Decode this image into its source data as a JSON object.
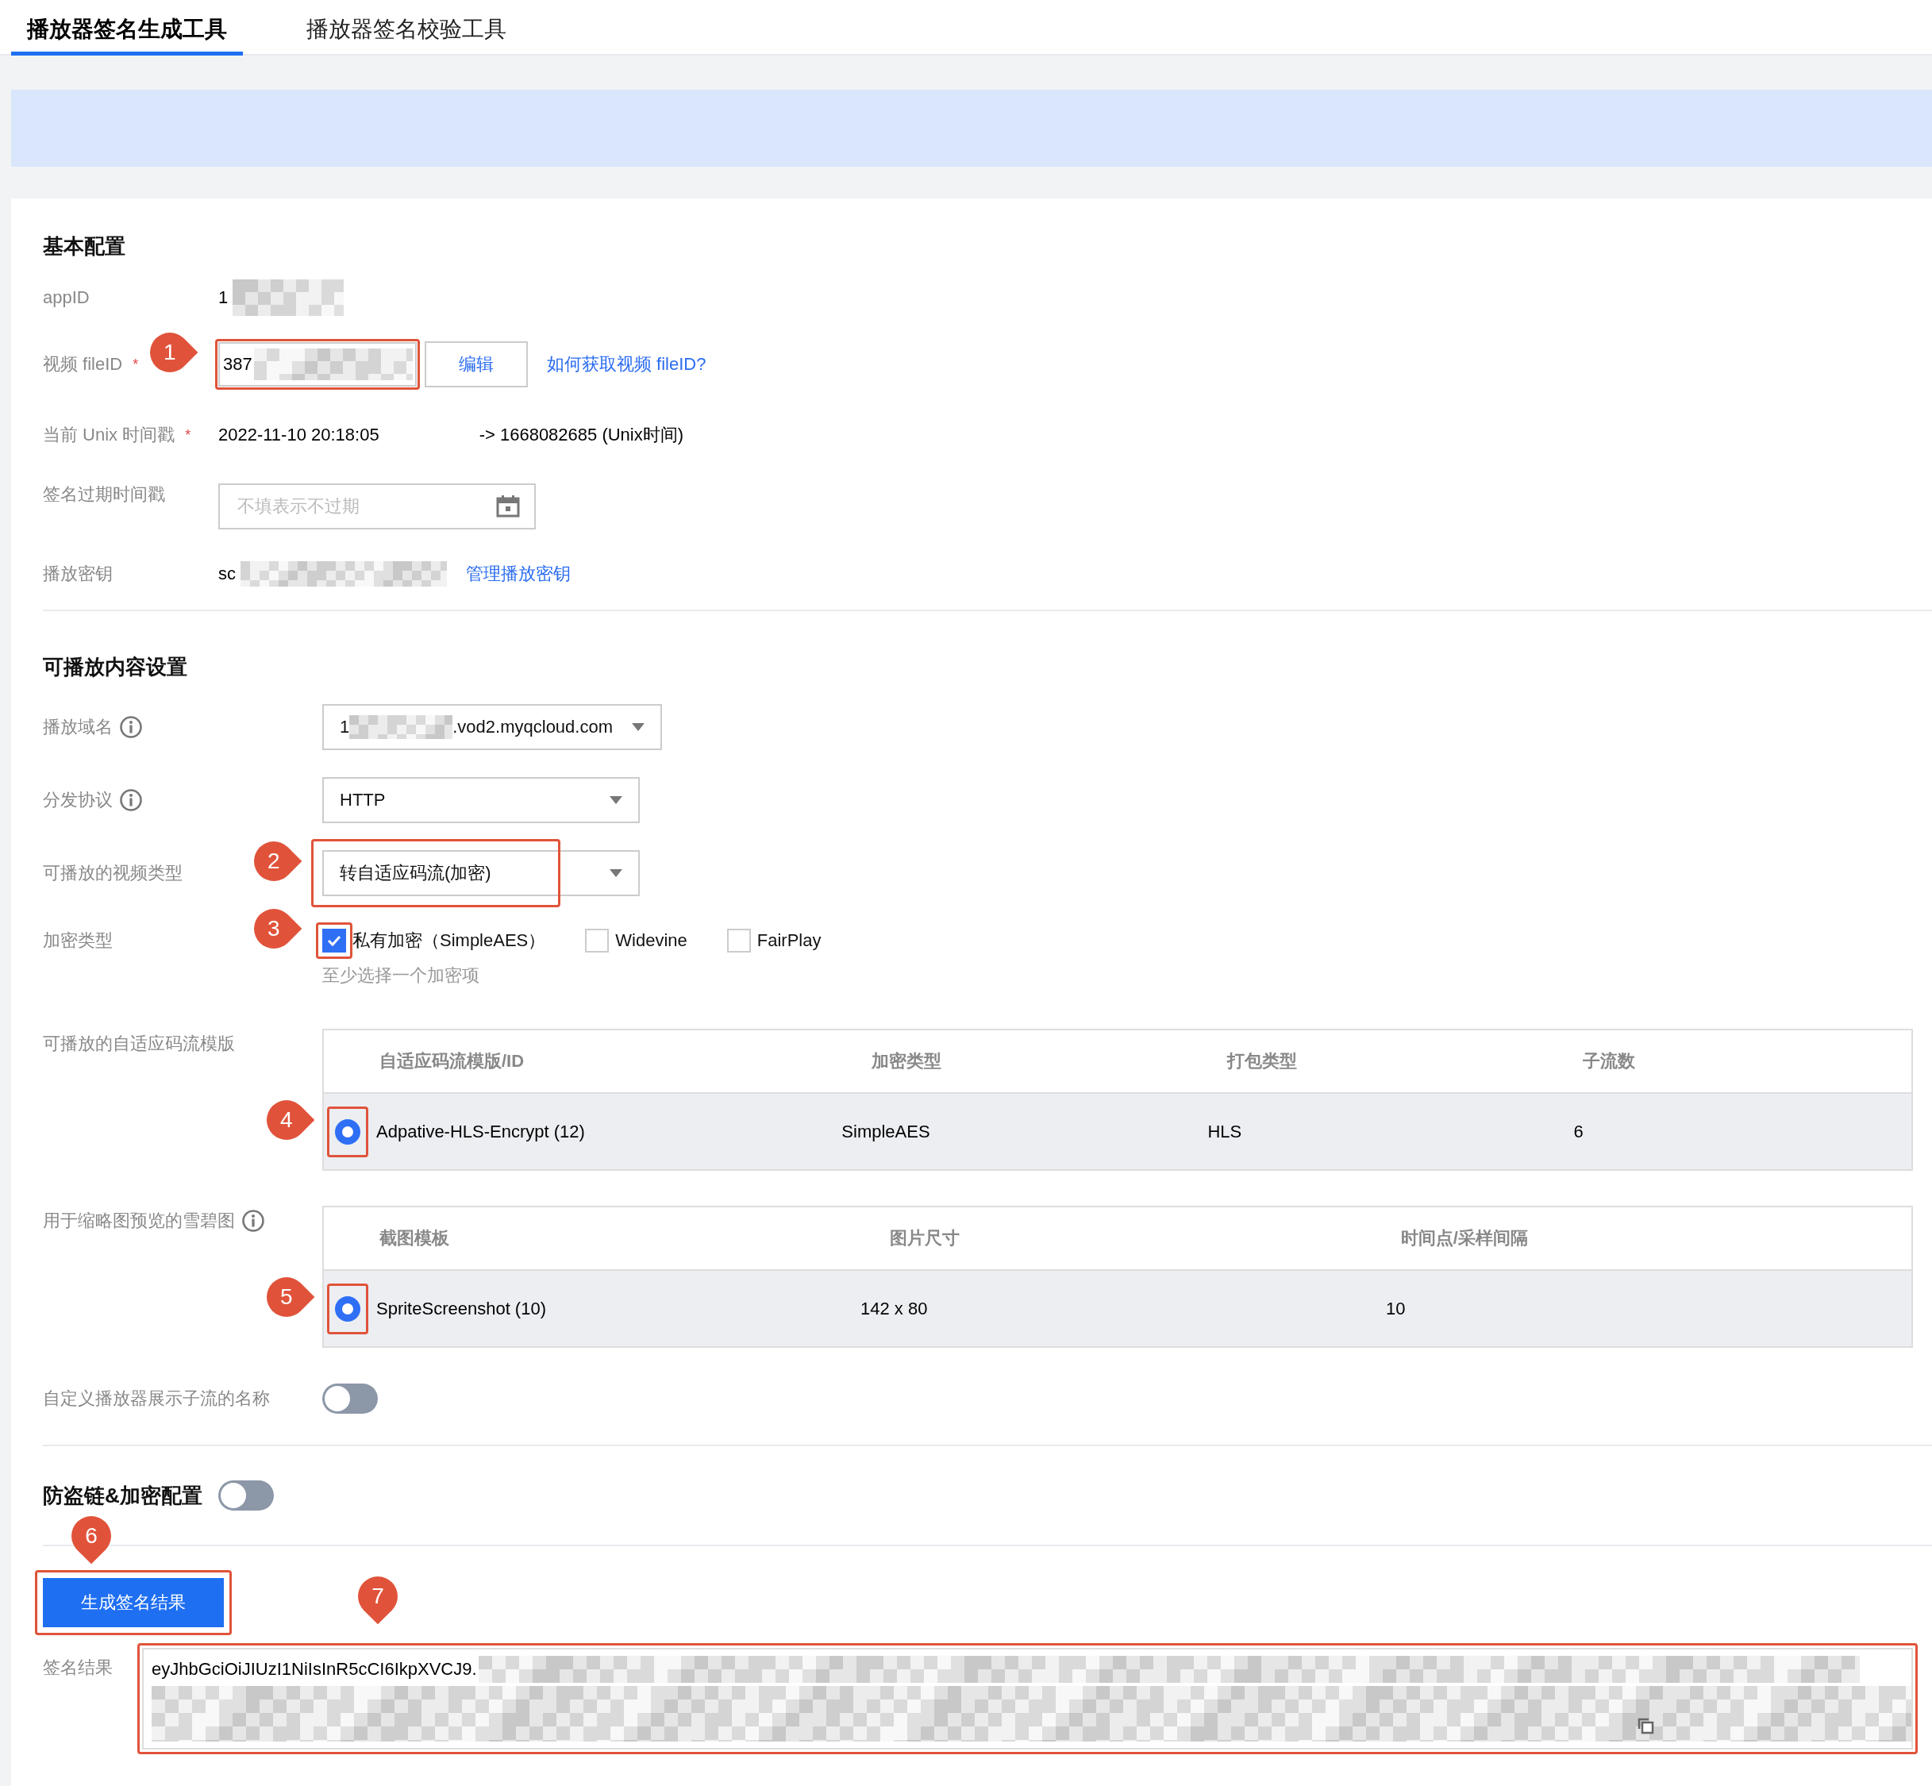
{
  "tabs": [
    {
      "label": "播放器签名生成工具",
      "selected": true
    },
    {
      "label": "播放器签名校验工具",
      "selected": false
    }
  ],
  "basic": {
    "title": "基本配置",
    "rows": [
      {
        "kind": "text",
        "label": "appID",
        "value": "1",
        "redacted": true
      },
      {
        "kind": "input",
        "label": "视频 fileID",
        "required_mark": "*",
        "value": "387",
        "redacted": true,
        "button": "编辑",
        "link": "如何获取视频 fileID?",
        "callout": "1"
      },
      {
        "kind": "timestamp",
        "label": "当前 Unix 时间戳",
        "required_mark": "*",
        "value": "2022-11-10 20:18:05",
        "note": "-> 1668082685 (Unix时间)"
      },
      {
        "kind": "date",
        "label": "签名过期时间戳",
        "placeholder": "不填表示不过期"
      },
      {
        "kind": "text",
        "label": "播放密钥",
        "value": "sc",
        "redacted": true,
        "link": "管理播放密钥"
      }
    ]
  },
  "content": {
    "title": "可播放内容设置",
    "rows": [
      {
        "kind": "select",
        "label": "播放域名",
        "info": true,
        "value": "1",
        "redacted": true,
        "value_suffix": ".vod2.myqcloud.com"
      },
      {
        "kind": "select",
        "label": "分发协议",
        "info": true,
        "value": "HTTP"
      },
      {
        "kind": "select",
        "label": "可播放的视频类型",
        "info": false,
        "value": "转自适应码流(加密)",
        "callout": "2"
      },
      {
        "kind": "checks",
        "label": "加密类型",
        "hint": "至少选择一个加密项",
        "options": [
          {
            "label": "私有加密（SimpleAES）",
            "checked": true,
            "callout": "3"
          },
          {
            "label": "Widevine",
            "checked": false
          },
          {
            "label": "FairPlay",
            "checked": false
          }
        ]
      },
      {
        "kind": "table",
        "label": "可播放的自适应码流模版",
        "info": false,
        "columns": [
          "自适应码流模版/ID",
          "加密类型",
          "打包类型",
          "子流数"
        ],
        "rows": [
          {
            "selected": true,
            "callout": "4",
            "cells": [
              "Adpative-HLS-Encrypt (12)",
              "SimpleAES",
              "HLS",
              "6"
            ]
          }
        ]
      },
      {
        "kind": "table",
        "label": "用于缩略图预览的雪碧图",
        "info": true,
        "columns": [
          "截图模板",
          "图片尺寸",
          "时间点/采样间隔"
        ],
        "rows": [
          {
            "selected": true,
            "callout": "5",
            "cells": [
              "SpriteScreenshot (10)",
              "142 x 80",
              "10"
            ]
          }
        ]
      },
      {
        "kind": "toggle",
        "label": "自定义播放器展示子流的名称",
        "on": false
      }
    ]
  },
  "protection": {
    "title": "防盗链&加密配置",
    "on": false
  },
  "generate": {
    "label": "生成签名结果",
    "callout": "6"
  },
  "result": {
    "label": "签名结果",
    "value": "eyJhbGciOiJIUzI1NiIsInR5cCI6IkpXVCJ9.",
    "redacted": true,
    "callout": "7"
  }
}
